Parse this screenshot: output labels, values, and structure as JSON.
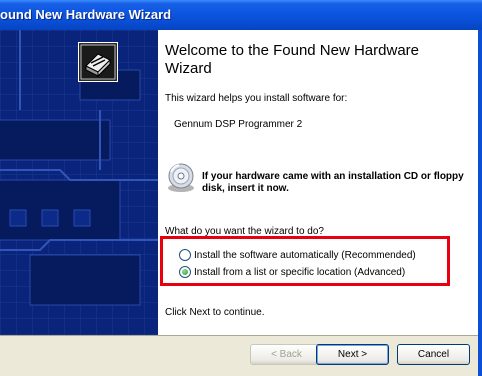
{
  "window": {
    "title": "ound New Hardware Wizard"
  },
  "content": {
    "heading": "Welcome to the Found New Hardware Wizard",
    "intro": "This wizard helps you install software for:",
    "device_name": "Gennum DSP Programmer 2",
    "cd_prompt": "If your hardware came with an installation CD or floppy disk, insert it now.",
    "question": "What do you want the wizard to do?",
    "options": [
      {
        "label": "Install the software automatically (Recommended)",
        "selected": false
      },
      {
        "label": "Install from a list or specific location (Advanced)",
        "selected": true
      }
    ],
    "continue_text": "Click Next to continue."
  },
  "buttons": {
    "back": "< Back",
    "next": "Next >",
    "cancel": "Cancel"
  },
  "colors": {
    "titlebar": "#0a4fd6",
    "side_panel": "#0a247b",
    "highlight_box": "#e8000f"
  }
}
